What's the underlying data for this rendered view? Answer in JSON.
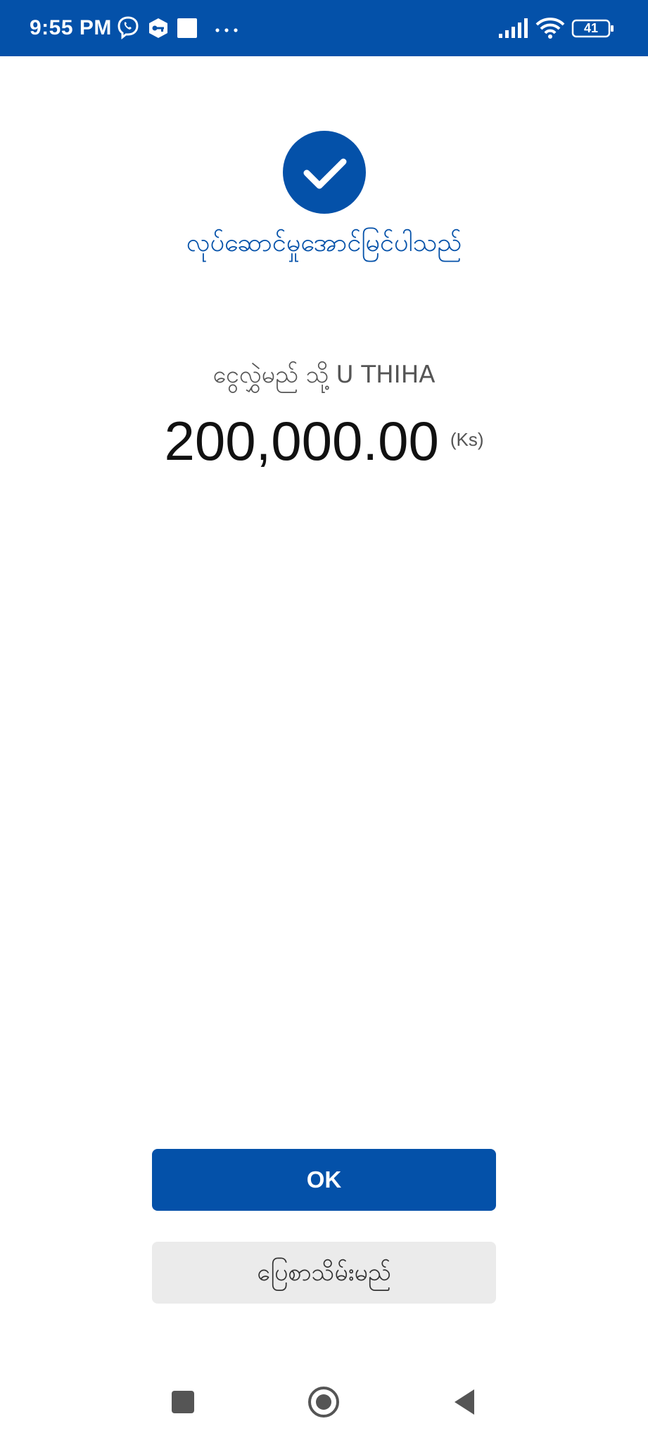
{
  "status_bar": {
    "time": "9:55 PM",
    "battery_level": "41",
    "icons": [
      "viber-icon",
      "vpn-key-icon",
      "app-square-icon",
      "more-dots-icon",
      "signal-icon",
      "wifi-icon",
      "battery-icon"
    ],
    "background_color": "#0451a9"
  },
  "result": {
    "status_icon": "checkmark-icon",
    "message": "လုပ်ဆောင်မှုအောင်မြင်ပါသည်",
    "recipient_prefix": "ငွေလွှဲမည် သို့",
    "recipient_name": "U THIHA",
    "amount": "200,000.00",
    "currency": "(Ks)"
  },
  "actions": {
    "ok_label": "OK",
    "receipt_label": "ပြေစာသိမ်းမည်"
  },
  "nav_bar": {
    "icons": [
      "recent-apps-icon",
      "home-icon",
      "back-icon"
    ]
  },
  "colors": {
    "accent": "#0451a9",
    "secondary_button": "#ebebeb"
  }
}
